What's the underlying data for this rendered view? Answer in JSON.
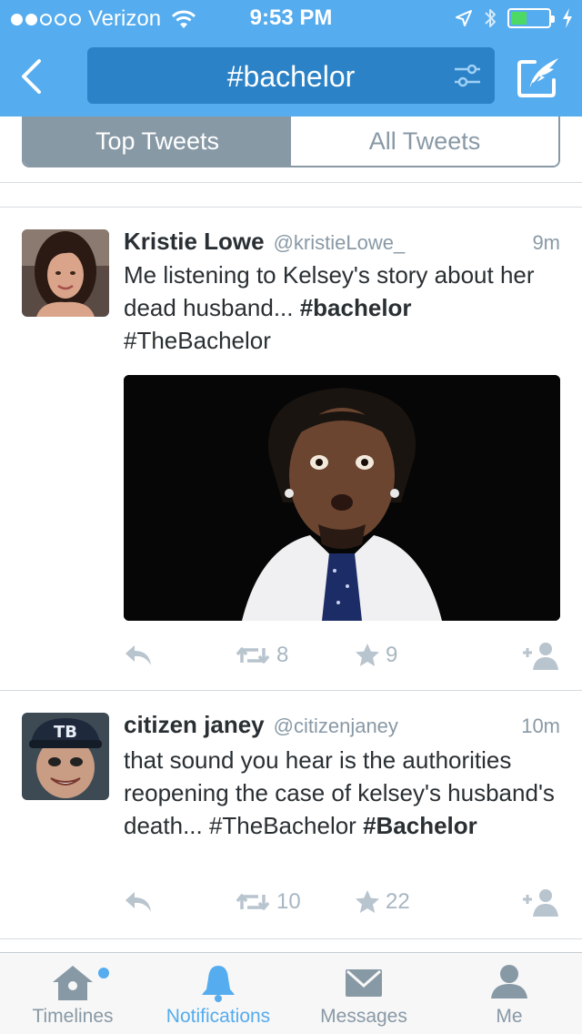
{
  "status_bar": {
    "carrier": "Verizon",
    "time": "9:53 PM",
    "signal_bars": 2,
    "battery_level": 0.4
  },
  "nav": {
    "search_term": "#bachelor"
  },
  "segments": {
    "top": "Top Tweets",
    "all": "All Tweets"
  },
  "tweets": [
    {
      "name": "Kristie Lowe",
      "handle": "@kristieLowe_",
      "time": "9m",
      "text_plain1": "Me listening to Kelsey's story about her dead husband... ",
      "text_bold1": "#bachelor",
      "text_plain2": " #TheBachelor",
      "retweets": "8",
      "favorites": "9"
    },
    {
      "name": "citizen janey",
      "handle": "@citizenjaney",
      "time": "10m",
      "text_plain1": "that sound you hear is the authorities reopening the case of kelsey's husband's death... #TheBachelor ",
      "text_bold1": "#Bachelor",
      "avatar_cap_text": "TB",
      "retweets": "10",
      "favorites": "22"
    }
  ],
  "tabbar": {
    "timelines": "Timelines",
    "notifications": "Notifications",
    "messages": "Messages",
    "me": "Me"
  },
  "colors": {
    "brand_blue": "#55acee",
    "search_pill": "#2c82c6",
    "segment_gray": "#8899a6",
    "battery_green": "#4cd964"
  }
}
